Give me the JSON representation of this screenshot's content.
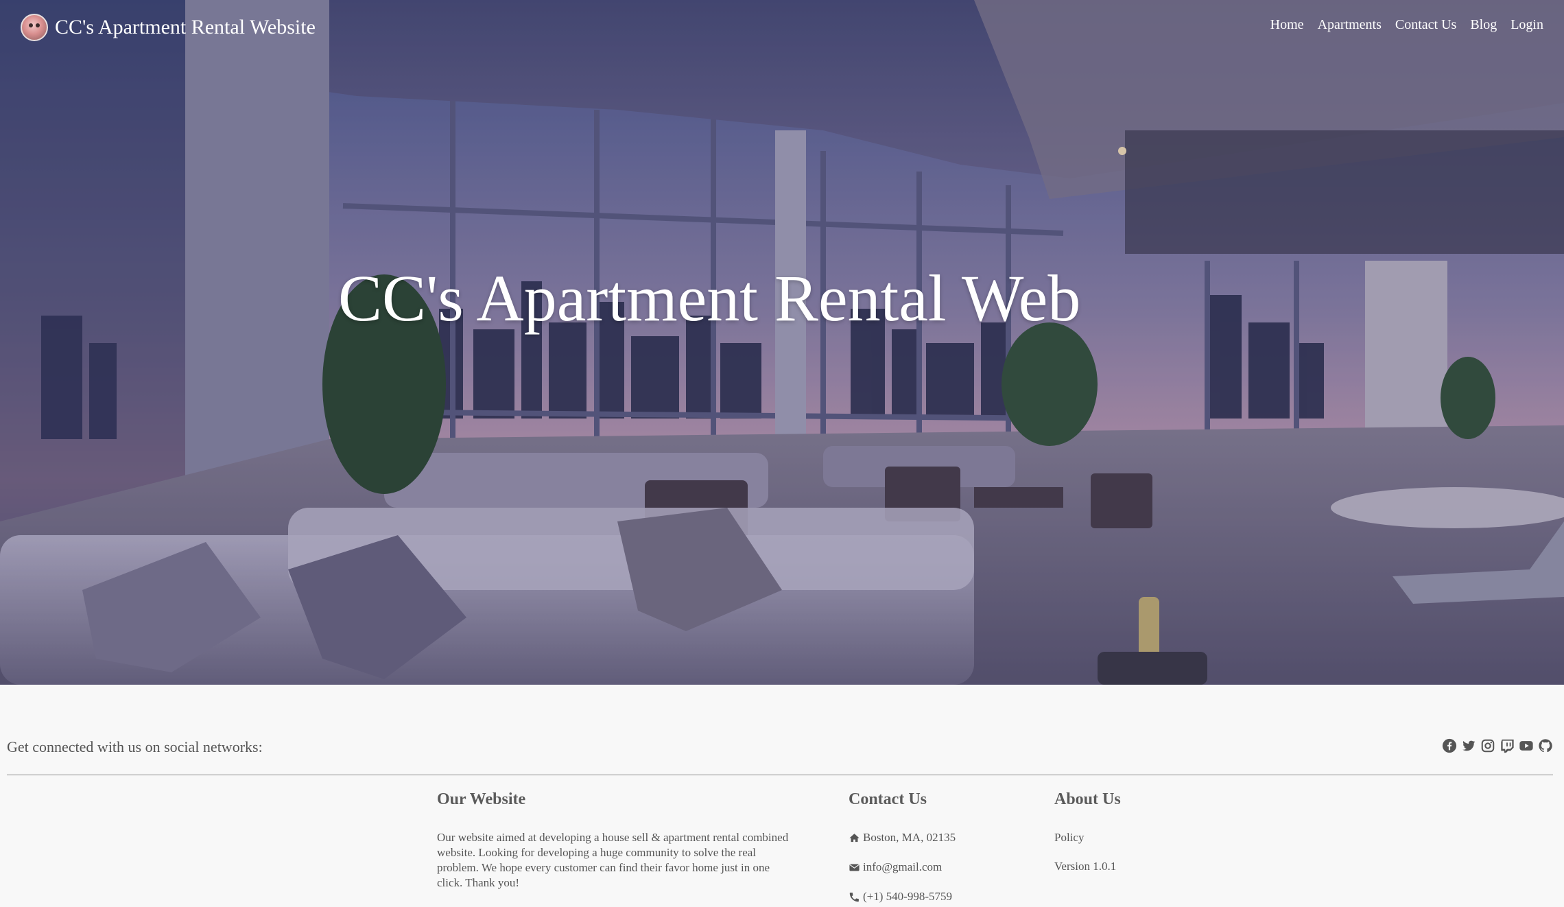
{
  "navbar": {
    "brand": "CC's Apartment Rental Website",
    "links": [
      "Home",
      "Apartments",
      "Contact Us",
      "Blog",
      "Login"
    ]
  },
  "hero": {
    "title": "CC's Apartment Rental Web"
  },
  "footer": {
    "social_text": "Get connected with us on social networks:",
    "social_icons": [
      "facebook-icon",
      "twitter-icon",
      "instagram-icon",
      "twitch-icon",
      "youtube-icon",
      "github-icon"
    ],
    "website": {
      "heading": "Our Website",
      "text": "Our website aimed at developing a house sell & apartment rental combined website. Looking for developing a huge community to solve the real problem. We hope every customer can find their favor home just in one click. Thank you!"
    },
    "contact": {
      "heading": "Contact Us",
      "address": "Boston, MA, 02135",
      "email": "info@gmail.com",
      "phone": "(+1) 540-998-5759"
    },
    "about": {
      "heading": "About Us",
      "items": [
        "Policy",
        "Version 1.0.1"
      ]
    }
  },
  "colors": {
    "footer_bg": "#f8f8f8",
    "footer_text": "#555555",
    "nav_text": "#ffffff"
  }
}
